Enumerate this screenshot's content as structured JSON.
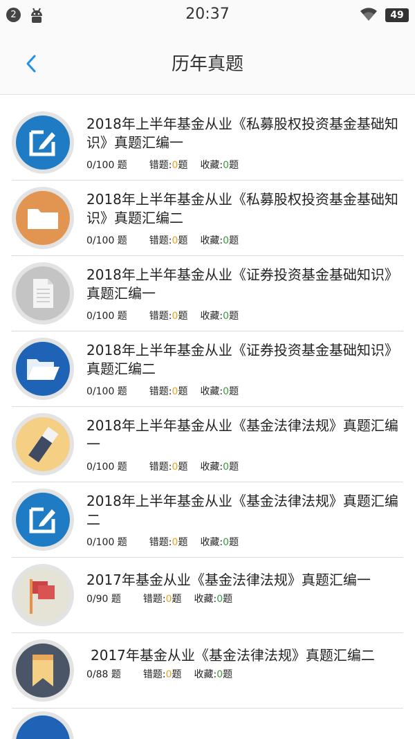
{
  "status_bar": {
    "notification_count": "2",
    "time": "20:37",
    "battery": "49",
    "icons": [
      "android-icon",
      "wifi-icon",
      "battery-icon"
    ]
  },
  "nav": {
    "title": "历年真题",
    "back_icon": "chevron-left-icon"
  },
  "items": [
    {
      "title": "2018年上半年基金从业《私募股权投资基金基础知识》真题汇编一",
      "progress": "0/100 题",
      "wrong_label": "错题:",
      "wrong_count": "0",
      "wrong_unit": "题",
      "fav_label": "收藏:",
      "fav_count": "0",
      "fav_unit": "题",
      "icon": "edit-icon",
      "icon_color": "#1e7bc4"
    },
    {
      "title": "2018年上半年基金从业《私募股权投资基金基础知识》真题汇编二",
      "progress": "0/100 题",
      "wrong_label": "错题:",
      "wrong_count": "0",
      "wrong_unit": "题",
      "fav_label": "收藏:",
      "fav_count": "0",
      "fav_unit": "题",
      "icon": "folder-icon",
      "icon_color": "#e29550"
    },
    {
      "title": "2018年上半年基金从业《证券投资基金基础知识》真题汇编一",
      "progress": "0/100 题",
      "wrong_label": "错题:",
      "wrong_count": "0",
      "wrong_unit": "题",
      "fav_label": "收藏:",
      "fav_count": "0",
      "fav_unit": "题",
      "icon": "document-icon",
      "icon_color": "#c4c4c4"
    },
    {
      "title": "2018年上半年基金从业《证券投资基金基础知识》真题汇编二",
      "progress": "0/100 题",
      "wrong_label": "错题:",
      "wrong_count": "0",
      "wrong_unit": "题",
      "fav_label": "收藏:",
      "fav_count": "0",
      "fav_unit": "题",
      "icon": "open-folder-icon",
      "icon_color": "#1e63b5"
    },
    {
      "title": "2018年上半年基金从业《基金法律法规》真题汇编一",
      "progress": "0/100 题",
      "wrong_label": "错题:",
      "wrong_count": "0",
      "wrong_unit": "题",
      "fav_label": "收藏:",
      "fav_count": "0",
      "fav_unit": "题",
      "icon": "eraser-icon",
      "icon_color": "#f5cf84"
    },
    {
      "title": "2018年上半年基金从业《基金法律法规》真题汇编二",
      "progress": "0/100 题",
      "wrong_label": "错题:",
      "wrong_count": "0",
      "wrong_unit": "题",
      "fav_label": "收藏:",
      "fav_count": "0",
      "fav_unit": "题",
      "icon": "edit-icon",
      "icon_color": "#1e7bc4"
    },
    {
      "title": "2017年基金从业《基金法律法规》真题汇编一",
      "progress": "0/90 题",
      "wrong_label": "错题:",
      "wrong_count": "0",
      "wrong_unit": "题",
      "fav_label": "收藏:",
      "fav_count": "0",
      "fav_unit": "题",
      "icon": "flag-icon",
      "icon_color": "#e5e2d6"
    },
    {
      "title": "2017年基金从业《基金法律法规》真题汇编二",
      "progress": "0/88 题",
      "wrong_label": "错题:",
      "wrong_count": "0",
      "wrong_unit": "题",
      "fav_label": "收藏:",
      "fav_count": "0",
      "fav_unit": "题",
      "icon": "bookmark-icon",
      "icon_color": "#4b5568"
    }
  ]
}
